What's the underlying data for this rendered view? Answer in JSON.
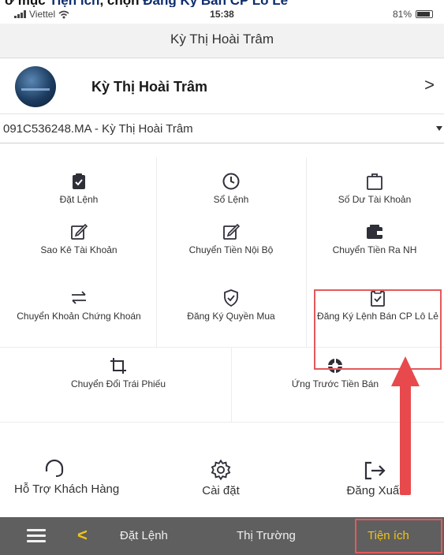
{
  "caption": {
    "text_pre": "ở mục ",
    "text_bold1": "Tiện ích",
    "text_mid": ", chọn ",
    "text_bold2": "Đăng Ký Bán CP Lô Lẻ"
  },
  "status_bar": {
    "carrier": "Viettel",
    "time": "15:38",
    "battery": "81%"
  },
  "header": {
    "title": "Kỳ Thị Hoài Trâm"
  },
  "profile": {
    "name": "Kỳ Thị Hoài Trâm",
    "chevron": ">"
  },
  "account": {
    "selected": "091C536248.MA - Kỳ Thị Hoài Trâm"
  },
  "menu": {
    "dat_lenh": "Đặt Lệnh",
    "so_lenh": "Sổ Lệnh",
    "so_du": "Số Dư Tài Khoản",
    "sao_ke": "Sao Kê Tài Khoản",
    "chuyen_tien_noi_bo": "Chuyển Tiền Nội Bộ",
    "chuyen_tien_ra_nh": "Chuyển Tiền Ra NH",
    "chuyen_khoan_ck": "Chuyển Khoản Chứng Khoán",
    "dang_ky_quyen_mua": "Đăng Ký Quyền Mua",
    "dang_ky_lenh_ban": "Đăng Ký Lệnh Bán CP Lô Lẻ",
    "chuyen_doi_tp": "Chuyển Đổi Trái Phiếu",
    "ung_truoc": "Ứng Trước Tiền Bán"
  },
  "actions": {
    "support": "Hỗ Trợ Khách Hàng",
    "settings": "Cài đặt",
    "logout": "Đăng Xuất"
  },
  "bottom_nav": {
    "back": "<",
    "items": [
      "Đặt Lệnh",
      "Thị Trường",
      "Tiện ích"
    ],
    "active": "Tiện ích"
  },
  "colors": {
    "accent_yellow": "#f0c419",
    "highlight_red": "#e35a5a",
    "nav_bg": "#5f5f5f"
  }
}
